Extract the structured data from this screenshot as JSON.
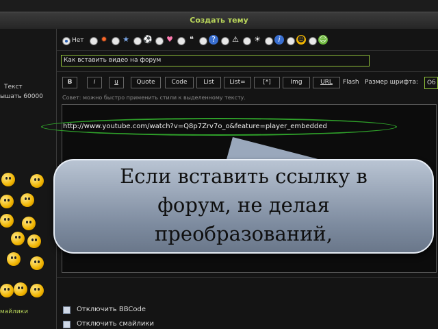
{
  "header": {
    "title": "Создать тему"
  },
  "sidebar": {
    "text_line1": "Текст",
    "text_line2": "ышать 60000",
    "smilies_link": "майлики"
  },
  "icons": {
    "none_label": "Нет",
    "emoticons": [
      "fire-icon",
      "star-icon",
      "soccer-icon",
      "heart-icon",
      "speech-icon",
      "question-icon",
      "warning-icon",
      "idea-icon",
      "info-icon",
      "smile-icon",
      "grin-icon"
    ]
  },
  "subject": {
    "value": "Как вставить видео на форум"
  },
  "toolbar": {
    "buttons": [
      "B",
      "i",
      "u",
      "Quote",
      "Code",
      "List",
      "List=",
      "[*]",
      "Img",
      "URL"
    ],
    "flash_label": "Flash",
    "font_size_label": "Размер шрифта:",
    "font_size_value": "Об"
  },
  "hint": "Совет: можно быстро применить стили к выделенному тексту.",
  "message": {
    "url": "http://www.youtube.com/watch?v=Q8p7Zrv7o_o&feature=player_embedded"
  },
  "callout": {
    "line1": "Если вставить ссылку в",
    "line2": "форум, не делая",
    "line3": "преобразований,"
  },
  "options": {
    "disable_bbcode": "Отключить BBCode",
    "disable_smilies": "Отключить смайлики"
  }
}
